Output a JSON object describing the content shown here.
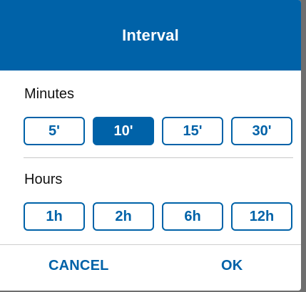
{
  "dialog": {
    "title": "Interval",
    "minutes": {
      "label": "Minutes",
      "options": [
        "5'",
        "10'",
        "15'",
        "30'"
      ],
      "selected": "10'"
    },
    "hours": {
      "label": "Hours",
      "options": [
        "1h",
        "2h",
        "6h",
        "12h"
      ],
      "selected": null
    },
    "actions": {
      "cancel_label": "CANCEL",
      "ok_label": "OK"
    }
  },
  "colors": {
    "accent": "#0062a8",
    "backdrop": "#6e6e6e"
  }
}
